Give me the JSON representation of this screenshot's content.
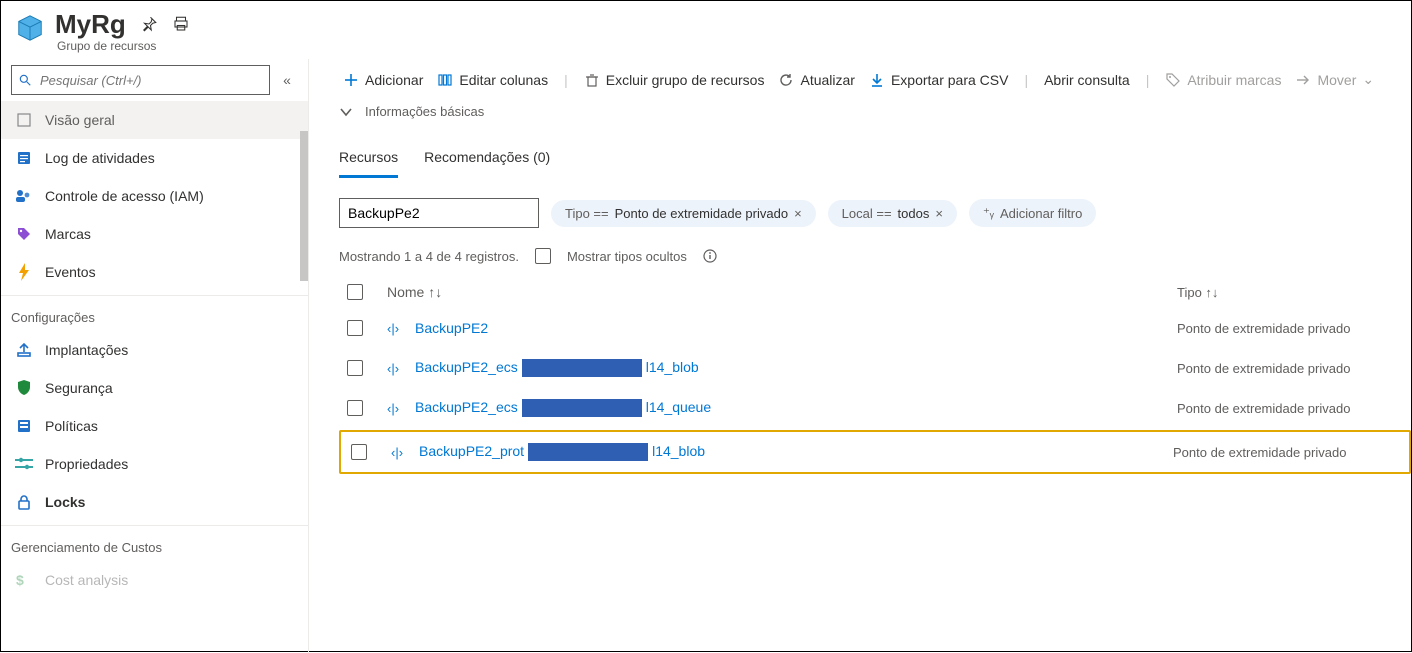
{
  "header": {
    "title": "MyRg",
    "subtitle": "Grupo de recursos"
  },
  "search": {
    "placeholder": "Pesquisar (Ctrl+/)"
  },
  "sidebar": {
    "items": [
      {
        "label": "Visão geral"
      },
      {
        "label": "Log de atividades"
      },
      {
        "label": "Controle de acesso (IAM)"
      },
      {
        "label": "Marcas"
      },
      {
        "label": "Eventos"
      }
    ],
    "section1": "Configurações",
    "config": [
      {
        "label": "Implantações"
      },
      {
        "label": "Segurança"
      },
      {
        "label": "Políticas"
      },
      {
        "label": "Propriedades"
      },
      {
        "label": "Locks"
      }
    ],
    "section2": "Gerenciamento de Custos",
    "cost0": "Cost analysis"
  },
  "toolbar": {
    "add": "Adicionar",
    "edit_cols": "Editar colunas",
    "delete_rg": "Excluir grupo de recursos",
    "refresh": "Atualizar",
    "export_csv": "Exportar para CSV",
    "open_query": "Abrir consulta",
    "assign_tags": "Atribuir marcas",
    "move": "Mover"
  },
  "info_bar": "Informações básicas",
  "tabs": {
    "resources": "Recursos",
    "recs": "Recomendações (0)"
  },
  "filters": {
    "value": "BackupPe2",
    "type_label": "Tipo ==",
    "type_value": "Ponto de extremidade privado",
    "type_x": "×",
    "loc_label": "Local ==",
    "loc_value": "todos",
    "loc_x": "×",
    "add": "Adicionar filtro",
    "add_prefix": "⁺ᵧ"
  },
  "showing": {
    "text": "Mostrando 1 a 4 de 4 registros.",
    "hidden": "Mostrar tipos ocultos"
  },
  "grid": {
    "col_name": "Nome ↑↓",
    "col_type": "Tipo ↑↓",
    "rows": [
      {
        "name_a": "BackupPE2",
        "name_b": "",
        "name_c": "",
        "type": "Ponto de extremidade privado"
      },
      {
        "name_a": "BackupPE2_ecs",
        "name_b": "",
        "name_c": "l14_blob",
        "type": "Ponto de extremidade privado"
      },
      {
        "name_a": "BackupPE2_ecs",
        "name_b": "",
        "name_c": "l14_queue",
        "type": "Ponto de extremidade privado"
      },
      {
        "name_a": "BackupPE2_prot",
        "name_b": "",
        "name_c": "l14_blob",
        "type": "Ponto de extremidade privado"
      }
    ]
  }
}
